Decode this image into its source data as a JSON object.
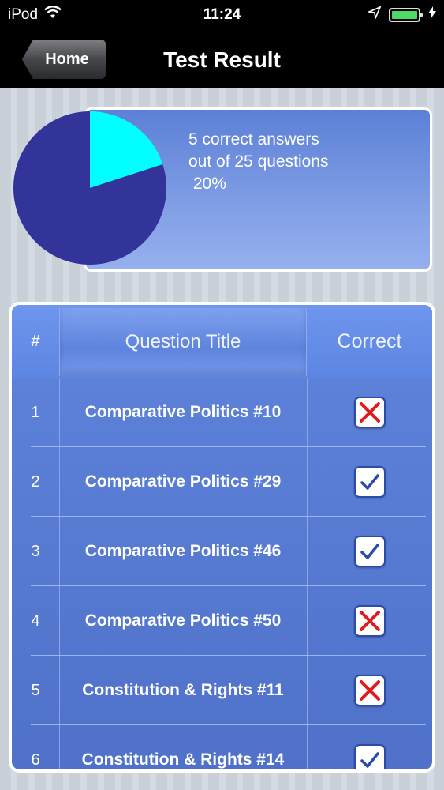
{
  "status_bar": {
    "carrier": "iPod",
    "time": "11:24",
    "icons": [
      "wifi-icon",
      "location-arrow-icon",
      "battery-icon",
      "charging-bolt-icon"
    ]
  },
  "nav": {
    "back_label": "Home",
    "title": "Test Result"
  },
  "summary": {
    "line1": "5 correct answers",
    "line2": "out of 25 questions",
    "line3": " 20%",
    "correct": 5,
    "total": 25,
    "percent": 20
  },
  "chart_data": {
    "type": "pie",
    "slices": [
      {
        "label": "correct",
        "value": 5,
        "color": "#00ffff"
      },
      {
        "label": "incorrect",
        "value": 20,
        "color": "#33349a"
      }
    ]
  },
  "table": {
    "headers": {
      "num": "#",
      "title": "Question Title",
      "correct": "Correct"
    },
    "rows": [
      {
        "num": "1",
        "title": "Comparative Politics #10",
        "correct": false
      },
      {
        "num": "2",
        "title": "Comparative Politics #29",
        "correct": true
      },
      {
        "num": "3",
        "title": "Comparative Politics #46",
        "correct": true
      },
      {
        "num": "4",
        "title": "Comparative Politics #50",
        "correct": false
      },
      {
        "num": "5",
        "title": "Constitution & Rights #11",
        "correct": false
      },
      {
        "num": "6",
        "title": "Constitution & Rights #14",
        "correct": true
      }
    ]
  },
  "colors": {
    "correct_mark": "#2c4ba8",
    "wrong_mark": "#e01b1b",
    "battery": "#4cd964"
  }
}
